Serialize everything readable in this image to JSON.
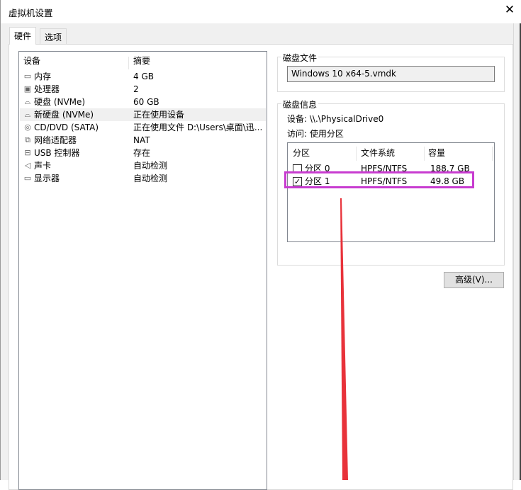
{
  "window": {
    "title": "虚拟机设置"
  },
  "tabs": [
    {
      "label": "硬件"
    },
    {
      "label": "选项"
    }
  ],
  "devices": {
    "headers": {
      "device": "设备",
      "summary": "摘要"
    },
    "items": [
      {
        "icon": "memory-icon",
        "name": "内存",
        "summary": "4 GB"
      },
      {
        "icon": "cpu-icon",
        "name": "处理器",
        "summary": "2"
      },
      {
        "icon": "disk-icon",
        "name": "硬盘 (NVMe)",
        "summary": "60 GB"
      },
      {
        "icon": "disk-icon",
        "name": "新硬盘 (NVMe)",
        "summary": "正在使用设备"
      },
      {
        "icon": "cd-icon",
        "name": "CD/DVD (SATA)",
        "summary": "正在使用文件 D:\\Users\\桌面\\迅..."
      },
      {
        "icon": "network-icon",
        "name": "网络适配器",
        "summary": "NAT"
      },
      {
        "icon": "usb-icon",
        "name": "USB 控制器",
        "summary": "存在"
      },
      {
        "icon": "speaker-icon",
        "name": "声卡",
        "summary": "自动检测"
      },
      {
        "icon": "monitor-icon",
        "name": "显示器",
        "summary": "自动检测"
      }
    ],
    "selected_index": 3
  },
  "disk_file": {
    "label": "磁盘文件",
    "value": "Windows 10 x64-5.vmdk"
  },
  "disk_info": {
    "label": "磁盘信息",
    "device": "设备: \\\\.\\PhysicalDrive0",
    "access": "访问: 使用分区",
    "headers": {
      "partition": "分区",
      "fs": "文件系统",
      "capacity": "容量"
    },
    "partitions": [
      {
        "name": "分区 0",
        "fs": "HPFS/NTFS",
        "capacity": "188.7 GB",
        "checked": false
      },
      {
        "name": "分区 1",
        "fs": "HPFS/NTFS",
        "capacity": "49.8 GB",
        "checked": true
      }
    ]
  },
  "buttons": {
    "advanced": "高级(V)..."
  },
  "colors": {
    "highlight": "#c83cd0",
    "arrow": "#e8323a"
  }
}
